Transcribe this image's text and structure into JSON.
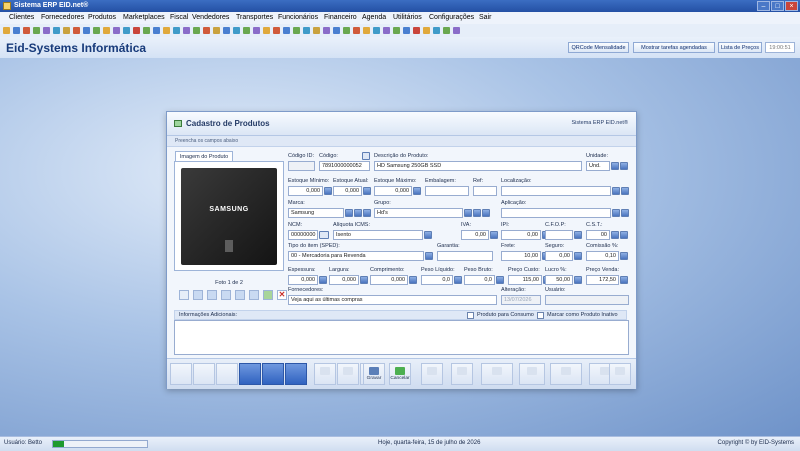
{
  "window": {
    "title": "Sistema ERP EID.net®"
  },
  "menu": [
    "Clientes",
    "Fornecedores",
    "Produtos",
    "Marketplaces",
    "Fiscal",
    "Vendedores",
    "Transportes",
    "Funcionários",
    "Financeiro",
    "Agenda",
    "Utilitários",
    "Configurações",
    "Sair"
  ],
  "header": {
    "company": "Eid-Systems Informática",
    "btn_qrcode": "QRCode Mensalidade",
    "btn_tarefas": "Mostrar tarefas agendadas",
    "btn_precos": "Lista de Preços",
    "clock": "19:00:51"
  },
  "dialog": {
    "title": "Cadastro de Produtos",
    "system": "Sistema ERP EID.net®",
    "hint": "Preencha os campos abaixo",
    "image_tab": "Imagem do Produto",
    "image_brand": "SAMSUNG",
    "photo_counter": "Foto 1 de 2"
  },
  "form": {
    "codigo_id_label": "Código ID:",
    "codigo_id": "",
    "codigo_label": "Código:",
    "codigo": "7891000000052",
    "descricao_label": "Descrição do Produto:",
    "descricao": "HD Samsung 250GB SSD",
    "unidade_label": "Unidade:",
    "unidade": "Und.",
    "estoque_min_label": "Estoque Mínimo:",
    "estoque_min": "0,000",
    "estoque_atual_label": "Estoque Atual:",
    "estoque_atual": "0,000",
    "estoque_max_label": "Estoque Máximo:",
    "estoque_max": "0,000",
    "embalagem_label": "Embalagem:",
    "embalagem": "",
    "ref_label": "Ref:",
    "ref": "",
    "localizacao_label": "Localização:",
    "localizacao": "",
    "marca_label": "Marca:",
    "marca": "Samsung",
    "grupo_label": "Grupo:",
    "grupo": "Hd's",
    "aplicacao_label": "Aplicação:",
    "aplicacao": "",
    "ncm_label": "NCM:",
    "ncm": "00000000",
    "aliquota_label": "Alíquota ICMS:",
    "aliquota": "Isento",
    "iva_label": "IVA:",
    "iva": "0,00",
    "ipi_label": "IPI:",
    "ipi": "0,00",
    "cfop_label": "C.F.O.P:",
    "cfop": "",
    "cst_label": "C.S.T.:",
    "cst": "00",
    "tipo_label": "Tipo do item (SPED):",
    "tipo": "00 - Mercadoria para Revenda",
    "garantia_label": "Garantia:",
    "garantia": "",
    "frete_label": "Frete:",
    "frete": "10,00",
    "seguro_label": "Seguro:",
    "seguro": "0,00",
    "comissao_label": "Comissão %:",
    "comissao": "0,10",
    "espessura_label": "Espessura:",
    "espessura": "0,000",
    "largura_label": "Largura:",
    "largura": "0,000",
    "comprimento_label": "Comprimento:",
    "comprimento": "0,000",
    "peso_liq_label": "Peso Líquido:",
    "peso_liq": "0,0",
    "peso_bruto_label": "Peso Bruto:",
    "peso_bruto": "0,0",
    "custo_label": "Preço Custo:",
    "custo": "115,00",
    "lucro_label": "Lucro %:",
    "lucro": "50,00",
    "venda_label": "Preço Venda:",
    "venda": "172,50",
    "fornecedores_label": "Fornecedores:",
    "fornecedores": "Veja aqui as últimas compras",
    "alteracao_label": "Alteração:",
    "alteracao": "13/07/2026",
    "usuario_label": "Usuário:",
    "usuario": "",
    "info_label": "Informações Adicionais:",
    "info": "",
    "consumo_label": "Produto para Consumo",
    "inativo_label": "Marcar como Produto Inativo"
  },
  "buttons": {
    "gravar": "Gravar",
    "cancelar": "Cancelar"
  },
  "status": {
    "user": "Usuário: Betto",
    "date": "Hoje, quarta-feira, 15 de julho de 2026",
    "copyright": "Copyright © by EID-Systems",
    "progress": 0.12
  },
  "colors": {
    "accent": "#2f62c0",
    "header_text": "#173a7a",
    "progress": "#1f9a2e"
  }
}
